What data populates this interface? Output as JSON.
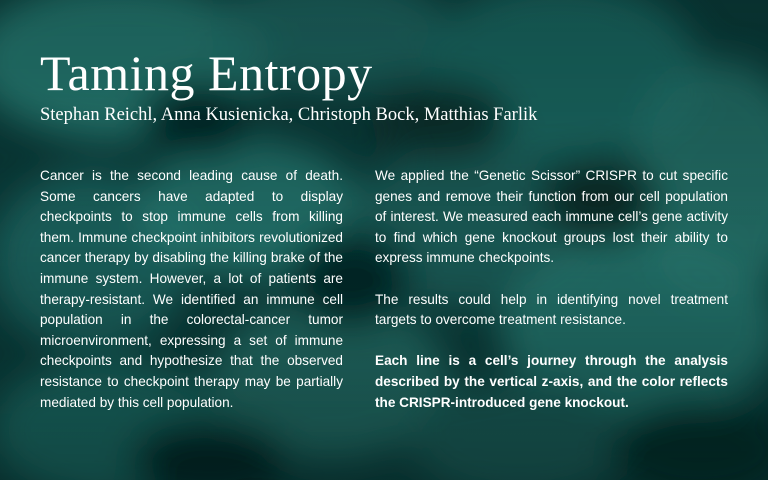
{
  "title": "Taming Entropy",
  "authors": "Stephan Reichl, Anna Kusienicka, Christoph Bock, Matthias Farlik",
  "left_column": {
    "paragraph": "Cancer is the second leading cause of death. Some cancers have adapted to display checkpoints to stop immune cells from killing them. Immune checkpoint inhibitors revolutionized cancer therapy by disabling the killing brake of the immune system. However, a lot of patients are therapy-resistant. We identified an immune cell population in the colorectal-cancer tumor microenvironment, expressing a set of immune checkpoints and hypothesize that the observed resistance to checkpoint therapy may be partially mediated by this cell population."
  },
  "right_column": {
    "paragraph1": "We applied the “Genetic Scissor” CRISPR to cut specific genes and remove their function from our cell population of interest. We measured each immune cell’s gene activity to find which gene knockout groups lost their ability to express immune checkpoints.",
    "paragraph2": "The results could help in identifying novel treatment targets to overcome treatment resistance.",
    "paragraph3_bold": "Each line is a cell’s journey through the analysis described by the vertical z-axis, and the color reflects the CRISPR-introduced gene knockout."
  },
  "colors": {
    "background": "#0b3a38",
    "blob_light": "#2f8a80",
    "blob_mid": "#1d6560",
    "blob_dark": "#062826",
    "text": "#ffffff"
  }
}
